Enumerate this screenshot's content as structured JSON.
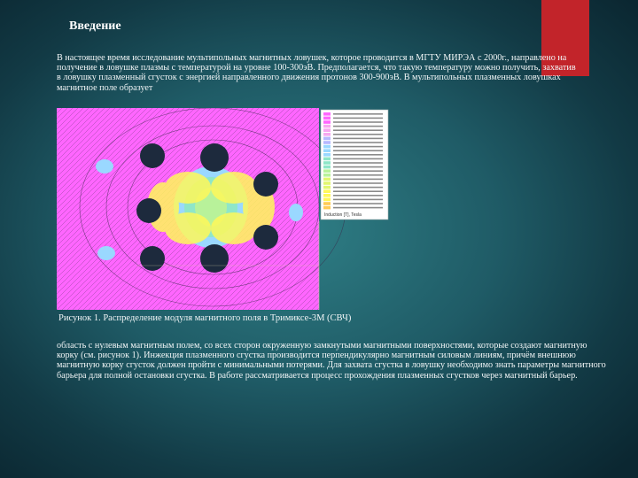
{
  "slide": {
    "title": "Введение",
    "accent_color": "#c2242a"
  },
  "intro": {
    "text": "В настоящее время исследование мультипольных магнитных ловушек, которое проводится в МГТУ МИРЭА с 2000г., направлено на получение в ловушке плазмы с температурой на уровне 100-300эВ. Предполагается, что такую температуру можно получить, захватив в ловушку плазменный сгусток с энергией направленного движения протонов 300-900эВ. В мультипольных плазменных ловушках магнитное поле образует"
  },
  "figure": {
    "caption": "Рисунок 1. Распределение модуля магнитного поля в Тримиксе-3М (СВЧ)",
    "legend_rows": 24,
    "legend_footer": "Induction [T], Tesla",
    "colors": [
      "#ff66ff",
      "#f7a8f0",
      "#b7b8ff",
      "#9ad8ff",
      "#8fe6c8",
      "#b8f29a",
      "#e2f770",
      "#fff85a",
      "#ffcc55"
    ]
  },
  "body": {
    "text": "область с нулевым магнитным полем, со всех сторон окруженную замкнутыми магнитными поверхностями, которые создают магнитную корку (см. рисунок 1). Инжекция плазменного сгустка производится перпендикулярно магнитным силовым линиям, причём внешнюю магнитную корку сгусток должен пройти с минимальными потерями. Для захвата сгустка в ловушку необходимо знать параметры магнитного барьера для полной остановки сгустка. В работе рассматривается процесс прохождения плазменных сгустков через магнитный барьер."
  }
}
